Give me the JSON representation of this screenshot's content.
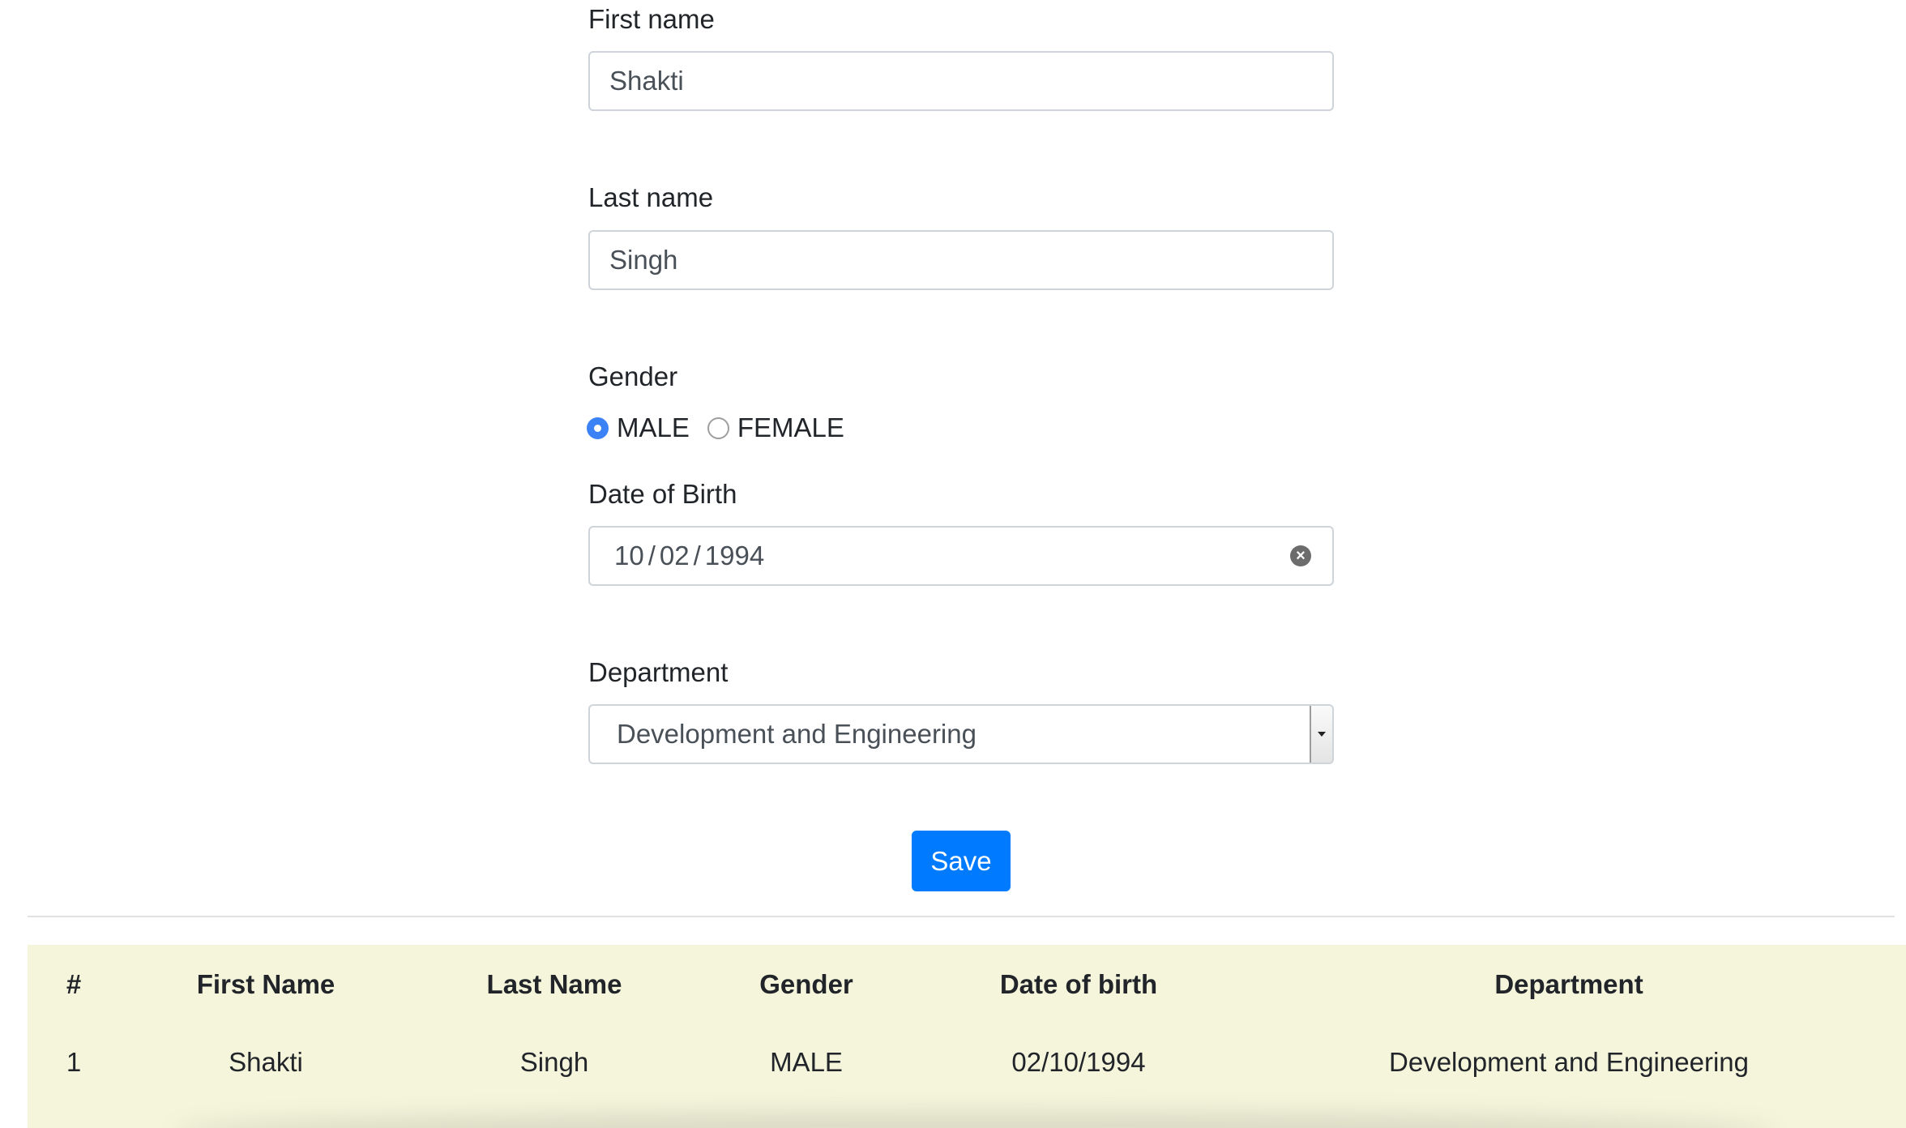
{
  "form": {
    "first_name": {
      "label": "First name",
      "value": "Shakti"
    },
    "last_name": {
      "label": "Last name",
      "value": "Singh"
    },
    "gender": {
      "label": "Gender",
      "options": [
        {
          "label": "MALE",
          "checked": true
        },
        {
          "label": "FEMALE",
          "checked": false
        }
      ]
    },
    "dob": {
      "label": "Date of Birth",
      "month": "10",
      "day": "02",
      "year": "1994",
      "separator": "/",
      "clear_icon": "clear-circle-icon"
    },
    "department": {
      "label": "Department",
      "value": "Development and Engineering",
      "arrow_icon": "chevron-down-icon"
    },
    "save_label": "Save"
  },
  "colors": {
    "primary": "#007bff",
    "radio_checked": "#3b82f6",
    "table_bg": "#f5f5dc"
  },
  "table": {
    "headers": [
      "#",
      "First Name",
      "Last Name",
      "Gender",
      "Date of birth",
      "Department"
    ],
    "rows": [
      [
        "1",
        "Shakti",
        "Singh",
        "MALE",
        "02/10/1994",
        "Development and Engineering"
      ]
    ]
  }
}
